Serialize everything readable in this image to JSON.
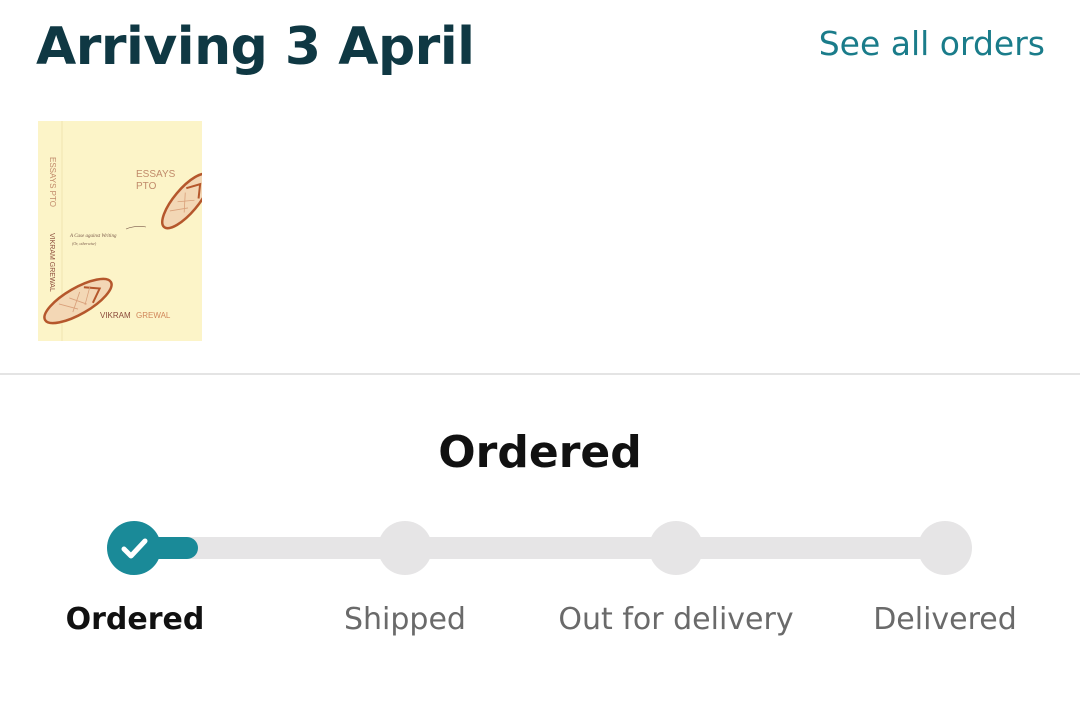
{
  "header": {
    "title": "Arriving 3 April",
    "see_all_link": "See all orders"
  },
  "item": {
    "thumbnail": {
      "spine_text": "ESSAYS PTO",
      "spine_author": "VIKRAM GREWAL",
      "cover_title_line1": "ESSAYS",
      "cover_title_line2": "PTO",
      "cover_subtitle": "A Case against Writing",
      "cover_subtitle2": "(Or, otherwise)",
      "cover_author_first": "VIKRAM",
      "cover_author_last": "GREWAL"
    }
  },
  "tracker": {
    "status_title": "Ordered",
    "progress_fraction": 0.08,
    "steps": [
      {
        "label": "Ordered",
        "state": "done"
      },
      {
        "label": "Shipped",
        "state": "pending"
      },
      {
        "label": "Out for delivery",
        "state": "pending"
      },
      {
        "label": "Delivered",
        "state": "pending"
      }
    ]
  },
  "colors": {
    "title": "#0f3843",
    "link": "#1a7c8a",
    "accent": "#1a8a98",
    "track": "#e6e5e6"
  }
}
